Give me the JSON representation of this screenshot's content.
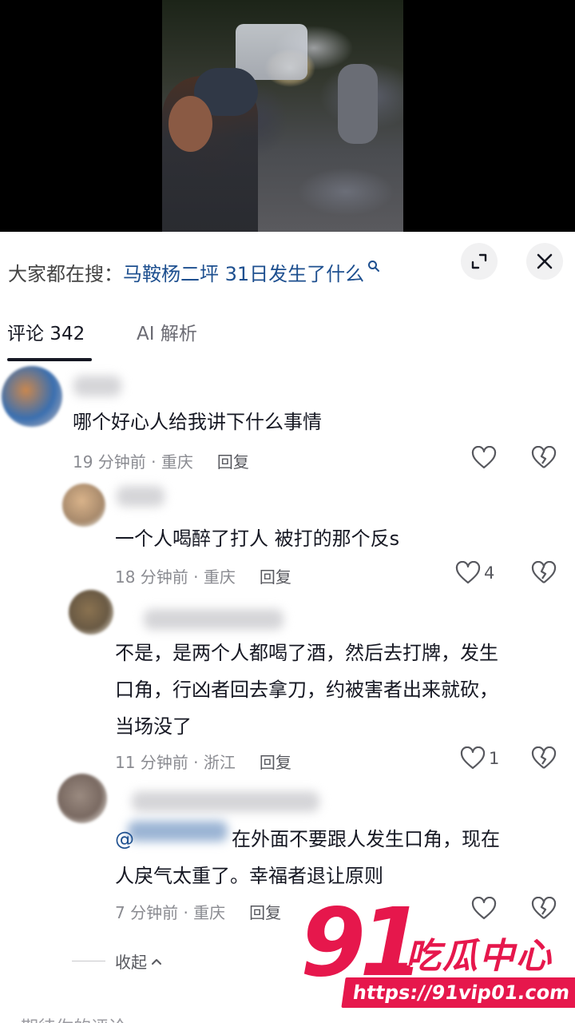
{
  "search": {
    "prefix": "大家都在搜：",
    "query": "马鞍杨二坪 31日发生了什么"
  },
  "tabs": [
    {
      "label": "评论 342",
      "active": true
    },
    {
      "label": "AI 解析",
      "active": false
    }
  ],
  "comments": [
    {
      "text": "哪个好心人给我讲下什么事情",
      "time": "19 分钟前 · 重庆",
      "reply": "回复",
      "likes": ""
    },
    {
      "text": "一个人喝醉了打人 被打的那个反s",
      "time": "18 分钟前 · 重庆",
      "reply": "回复",
      "likes": "4"
    },
    {
      "lines": [
        "不是，是两个人都喝了酒，然后去打牌，发生",
        "口角，行凶者回去拿刀，约被害者出来就砍，",
        "当场没了"
      ],
      "time": "11 分钟前 · 浙江",
      "reply": "回复",
      "likes": "1"
    },
    {
      "mention": "@",
      "lines": [
        "在外面不要跟人发生口角，现在",
        "人戾气太重了。幸福者退让原则"
      ],
      "time": "7 分钟前 · 重庆",
      "reply": "回复",
      "likes": ""
    }
  ],
  "collapse_label": "收起",
  "input_placeholder": "期待你的评论",
  "watermark": {
    "number": "91",
    "title": "吃瓜中心",
    "url": "https://91vip01.com"
  },
  "colors": {
    "accent": "#e6174c",
    "link": "#1d4f8f"
  }
}
